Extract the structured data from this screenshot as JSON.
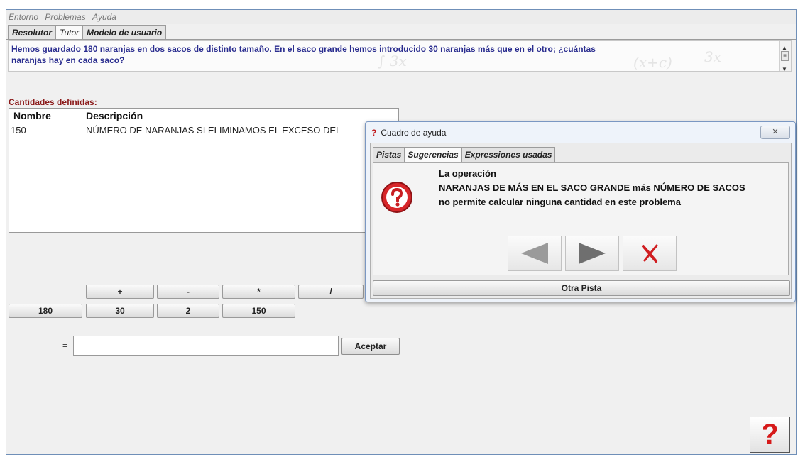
{
  "menu": [
    "Entorno",
    "Problemas",
    "Ayuda"
  ],
  "tabs": [
    "Resolutor",
    "Tutor",
    "Modelo de usuario"
  ],
  "problem_text_line1": "Hemos guardado 180 naranjas en dos sacos de distinto tamaño. En el saco grande hemos introducido 30 naranjas más que en el otro; ¿cuántas",
  "problem_text_line2": "naranjas hay en cada saco?",
  "quantities": {
    "title": "Cantidades definidas:",
    "col_name": "Nombre",
    "col_desc": "Descripción",
    "rows": [
      {
        "name": "150",
        "desc": "NÚMERO DE NARANJAS SI ELIMINAMOS EL EXCESO DEL"
      }
    ]
  },
  "operators": [
    "+",
    "-",
    "*",
    "/"
  ],
  "numbers": [
    "180",
    "30",
    "2",
    "150"
  ],
  "equation": {
    "label": "=",
    "value": "",
    "accept": "Aceptar"
  },
  "dialog": {
    "title": "Cuadro de ayuda",
    "tabs": [
      "Pistas",
      "Sugerencias",
      "Expressiones usadas"
    ],
    "active_tab": "Sugerencias",
    "message": [
      "La operación",
      "NARANJAS DE MÁS EN EL SACO GRANDE más NÚMERO DE SACOS",
      "no permite calcular ninguna cantidad en este problema"
    ],
    "other_hint": "Otra Pista"
  },
  "colors": {
    "accent_text": "#2a2d8f",
    "title_red": "#8b1a1a",
    "help_red": "#d61a1a"
  }
}
